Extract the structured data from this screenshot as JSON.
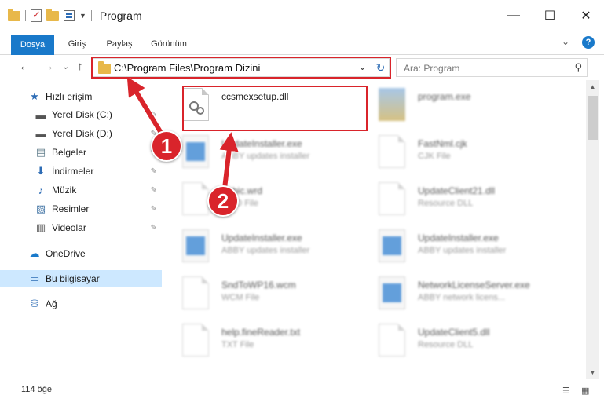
{
  "window": {
    "title": "Program",
    "minimize_icon": "minimize-icon",
    "maximize_icon": "maximize-icon",
    "close_icon": "close-icon",
    "min_glyph": "—",
    "max_glyph": "☐",
    "close_glyph": "✕"
  },
  "ribbon": {
    "tabs": [
      "Dosya",
      "Giriş",
      "Paylaş",
      "Görünüm"
    ],
    "expand_glyph": "⌄"
  },
  "address": {
    "path": "C:\\Program Files\\Program Dizini",
    "dropdown_glyph": "⌄",
    "refresh_glyph": "↻"
  },
  "search": {
    "placeholder": "Ara: Program",
    "icon_glyph": "⚲"
  },
  "nav": {
    "back_glyph": "←",
    "forward_glyph": "→",
    "recent_glyph": "⌄",
    "up_glyph": "↑",
    "items": [
      {
        "label": "Hızlı erişim",
        "icon": "★",
        "pinned": false
      },
      {
        "label": "Yerel Disk (C:)",
        "icon": "▬",
        "pinned": true
      },
      {
        "label": "Yerel Disk (D:)",
        "icon": "▬",
        "pinned": true
      },
      {
        "label": "Belgeler",
        "icon": "▤",
        "pinned": true
      },
      {
        "label": "İndirmeler",
        "icon": "⬇",
        "pinned": true
      },
      {
        "label": "Müzik",
        "icon": "♪",
        "pinned": true
      },
      {
        "label": "Resimler",
        "icon": "▧",
        "pinned": true
      },
      {
        "label": "Videolar",
        "icon": "▥",
        "pinned": true
      },
      {
        "label": "OneDrive",
        "icon": "☁",
        "pinned": false
      },
      {
        "label": "Bu bilgisayar",
        "icon": "▭",
        "pinned": false
      },
      {
        "label": "Ağ",
        "icon": "⛁",
        "pinned": false
      }
    ],
    "pin_glyph": "✎"
  },
  "files": [
    {
      "name": "ccsmexsetup.dll",
      "type": "",
      "kind": "dll",
      "selected": true
    },
    {
      "name": "program.exe",
      "type": "",
      "kind": "exe"
    },
    {
      "name": "UpdateInstaller.exe",
      "type": "ABBY updates installer",
      "kind": "app"
    },
    {
      "name": "FastNml.cjk",
      "type": "CJK File",
      "kind": "doc"
    },
    {
      "name": "Fabic.wrd",
      "type": "WRD File",
      "kind": "doc"
    },
    {
      "name": "UpdateClient21.dll",
      "type": "Resource DLL",
      "kind": "dll"
    },
    {
      "name": "UpdateInstaller.exe",
      "type": "ABBY updates installer",
      "kind": "app"
    },
    {
      "name": "UpdateInstaller.exe",
      "type": "ABBY updates installer",
      "kind": "app"
    },
    {
      "name": "SndToWP16.wcm",
      "type": "WCM File",
      "kind": "doc"
    },
    {
      "name": "NetworkLicenseServer.exe",
      "type": "ABBY network licens...",
      "kind": "app"
    },
    {
      "name": "help.fineReader.txt",
      "type": "TXT File",
      "kind": "doc"
    },
    {
      "name": "UpdateClient5.dll",
      "type": "Resource DLL",
      "kind": "dll"
    }
  ],
  "status": {
    "count": "114 öğe"
  },
  "annotations": {
    "badge1": "1",
    "badge2": "2",
    "accent": "#d9242b"
  }
}
